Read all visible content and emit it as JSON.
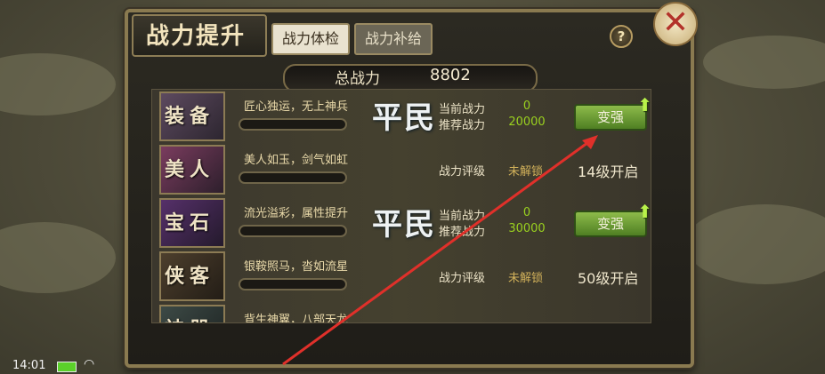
{
  "header": {
    "title": "战力提升",
    "tabs": [
      {
        "label": "战力体检",
        "active": true
      },
      {
        "label": "战力补给",
        "active": false
      }
    ],
    "help_glyph": "?",
    "close_glyph": "✕"
  },
  "total": {
    "label": "总战力",
    "value": "8802"
  },
  "rows": [
    {
      "name": "装备",
      "motto": "匠心独运，无上神兵",
      "rank": "平民",
      "current_label": "当前战力",
      "current_value": "0",
      "recommend_label": "推荐战力",
      "recommend_value": "20000",
      "button": "变强"
    },
    {
      "name": "美人",
      "motto": "美人如玉，剑气如虹",
      "rating_label": "战力评级",
      "rating_value": "未解锁",
      "unlock": "14级开启"
    },
    {
      "name": "宝石",
      "motto": "流光溢彩，属性提升",
      "rank": "平民",
      "current_label": "当前战力",
      "current_value": "0",
      "recommend_label": "推荐战力",
      "recommend_value": "30000",
      "button": "变强"
    },
    {
      "name": "侠客",
      "motto": "银鞍照马，沓如流星",
      "rating_label": "战力评级",
      "rating_value": "未解锁",
      "unlock": "50级开启"
    },
    {
      "name": "神器",
      "motto": "背生神翼，八部天龙"
    }
  ],
  "status": {
    "time": "14:01"
  },
  "colors": {
    "accent_green": "#9ad11f",
    "locked": "#d1b15a",
    "annotation_arrow": "#e0302a"
  }
}
